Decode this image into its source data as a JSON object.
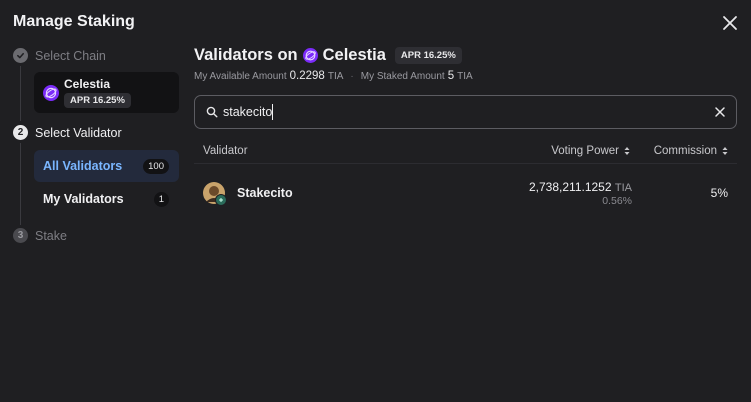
{
  "modal": {
    "title": "Manage Staking"
  },
  "steps": [
    {
      "number": "✓",
      "label": "Select Chain"
    },
    {
      "number": "2",
      "label": "Select Validator"
    },
    {
      "number": "3",
      "label": "Stake"
    }
  ],
  "chain_card": {
    "name": "Celestia",
    "apr": "APR 16.25%"
  },
  "nav": {
    "all": {
      "label": "All Validators",
      "count": "100"
    },
    "mine": {
      "label": "My Validators",
      "count": "1"
    }
  },
  "header": {
    "prefix": "Validators on",
    "chain": "Celestia",
    "apr": "APR 16.25%",
    "available_label": "My Available Amount",
    "available_value": "0.2298",
    "available_unit": "TIA",
    "staked_label": "My Staked Amount",
    "staked_value": "5",
    "staked_unit": "TIA"
  },
  "search": {
    "value": "stakecito",
    "placeholder": ""
  },
  "table": {
    "columns": {
      "validator": "Validator",
      "voting_power": "Voting Power",
      "commission": "Commission"
    },
    "rows": [
      {
        "name": "Stakecito",
        "voting_power": "2,738,211.1252",
        "unit": "TIA",
        "share": "0.56%",
        "commission": "5%"
      }
    ]
  },
  "colors": {
    "accent": "#7ab6ff",
    "celestia": "#7b2bf9",
    "background": "#1f1f22"
  },
  "icons": {
    "close": "close-icon",
    "search": "search-icon",
    "clear": "clear-icon",
    "check": "check-icon",
    "sort": "sort-icon",
    "chain": "celestia-logo-icon"
  }
}
